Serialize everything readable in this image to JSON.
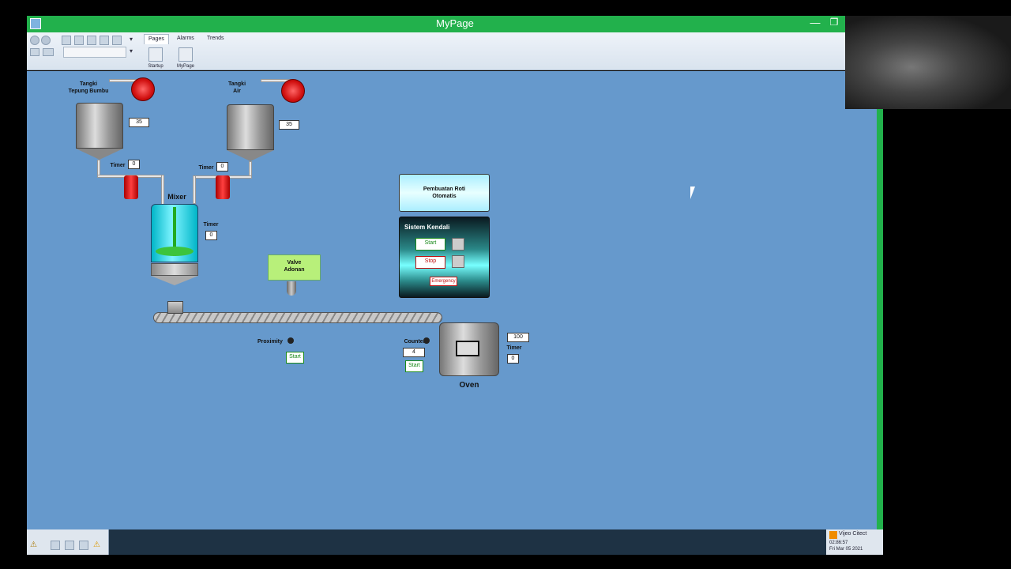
{
  "window": {
    "title": "MyPage",
    "min_label": "—",
    "max_label": "❐"
  },
  "ribbon": {
    "tabs": [
      "Pages",
      "Alarms",
      "Trends"
    ],
    "pages": [
      {
        "label": "Startup"
      },
      {
        "label": "MyPage"
      }
    ]
  },
  "plant": {
    "tank1": {
      "label_line1": "Tangki",
      "label_line2": "Tepung Bumbu",
      "value": "35"
    },
    "tank2": {
      "label_line1": "Tangki",
      "label_line2": "Air",
      "value": "35"
    },
    "timer1": {
      "label": "Timer",
      "value": "0"
    },
    "timer2": {
      "label": "Timer",
      "value": "0"
    },
    "mixer": {
      "label": "Mixer",
      "timer_label": "Timer",
      "timer_value": "0"
    },
    "valve": {
      "label_line1": "Valve",
      "label_line2": "Adonan"
    },
    "proximity": {
      "label": "Proximity",
      "button": "Start"
    },
    "counter": {
      "label": "Counter",
      "value": "4",
      "button": "Start"
    },
    "oven": {
      "label": "Oven",
      "setpoint": "100",
      "timer_label": "Timer",
      "timer_value": "0"
    }
  },
  "title_panel": {
    "line1": "Pembuatan Roti",
    "line2": "Otomatis"
  },
  "control_panel": {
    "title": "Sistem Kendali",
    "start": "Start",
    "stop": "Stop",
    "emergency": "Emergency"
  },
  "status": {
    "brand": "Vijeo Citect",
    "time": "02:86:57",
    "date": "Fri Mar 05 2021"
  },
  "colors": {
    "titlebar": "#22b14c",
    "canvas": "#6699cc",
    "pump": "#e02020"
  }
}
